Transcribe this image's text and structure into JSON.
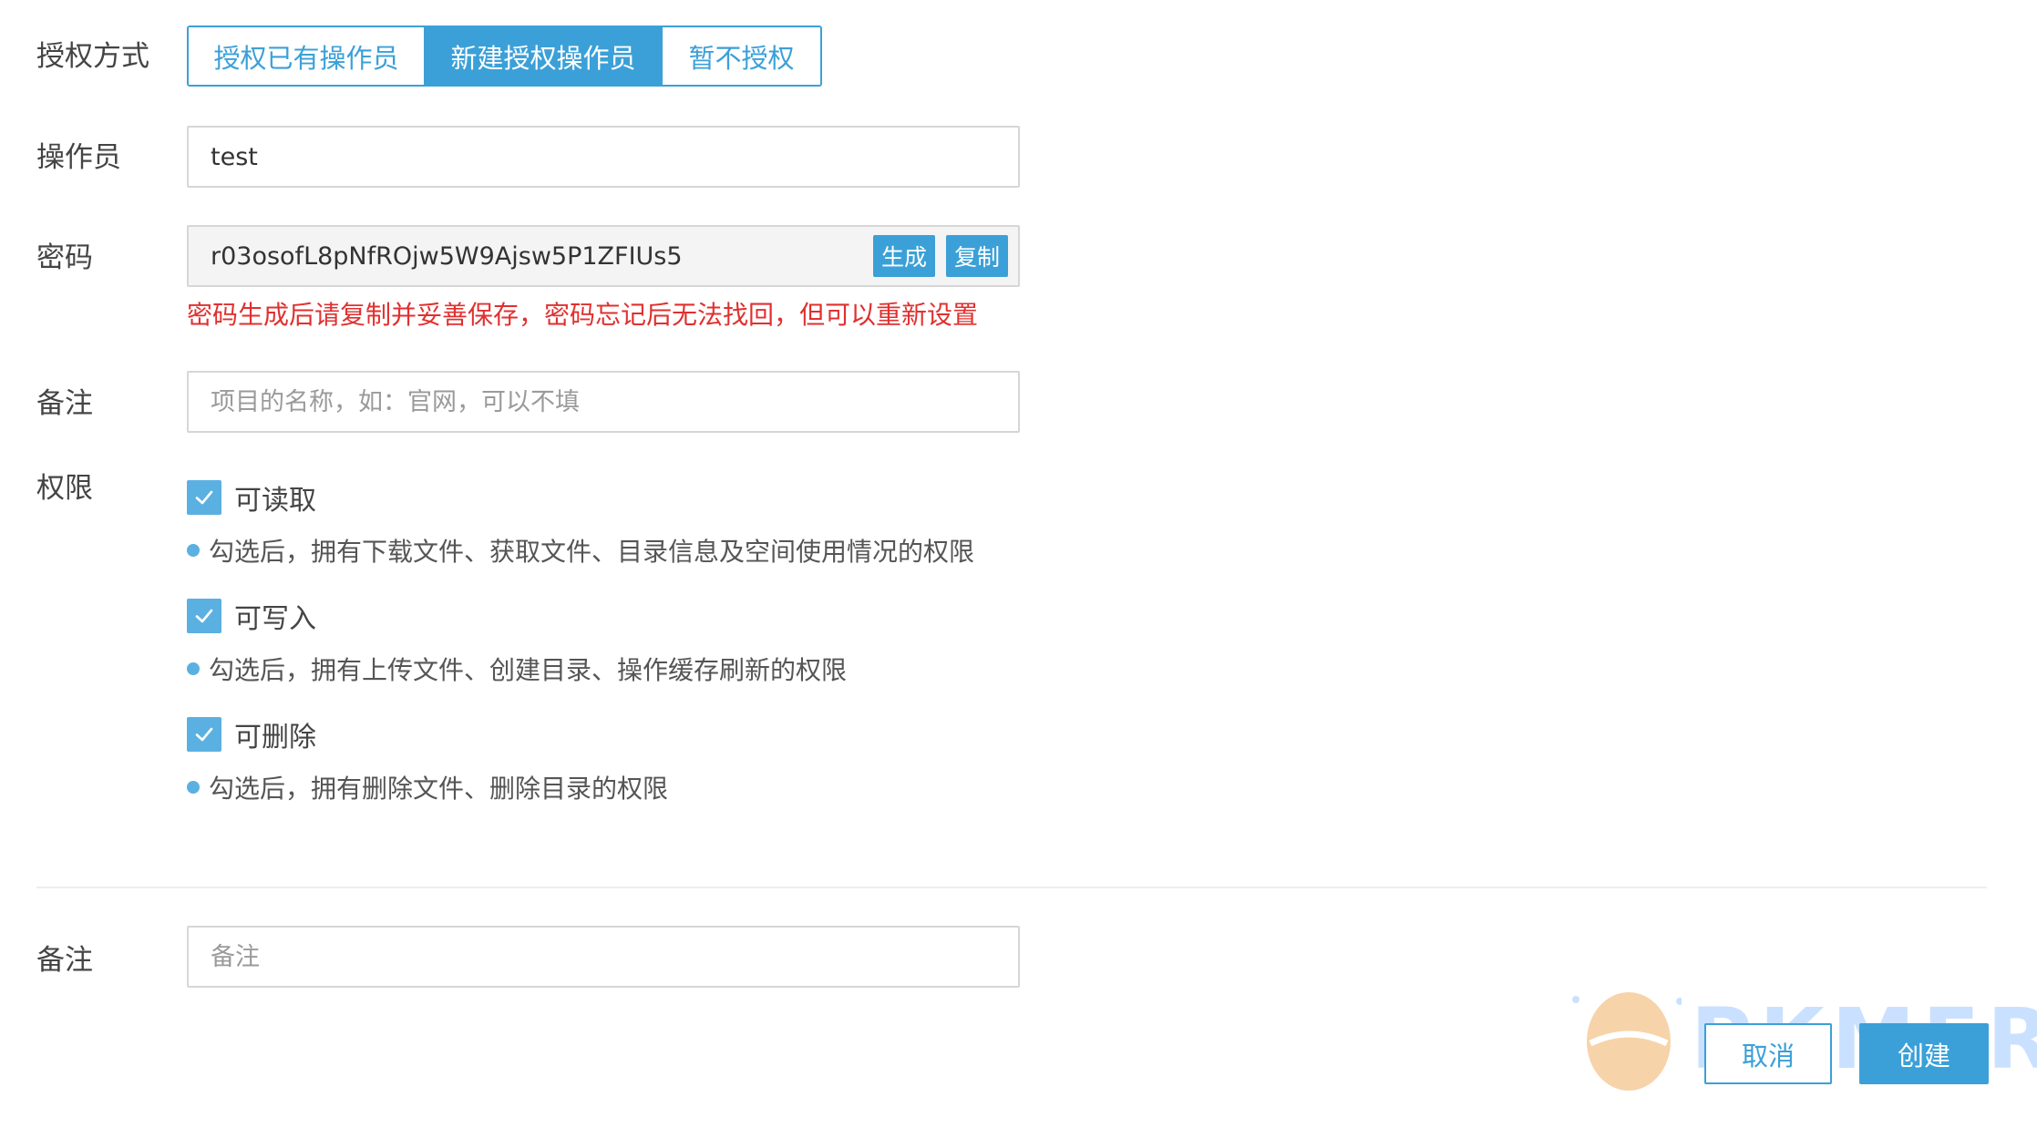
{
  "auth": {
    "label": "授权方式",
    "options": [
      "授权已有操作员",
      "新建授权操作员",
      "暂不授权"
    ],
    "selected_index": 1
  },
  "operator": {
    "label": "操作员",
    "value": "test"
  },
  "password": {
    "label": "密码",
    "value": "r03osofL8pNfROjw5W9Ajsw5P1ZFIUs5",
    "generate_label": "生成",
    "copy_label": "复制",
    "warning": "密码生成后请复制并妥善保存，密码忘记后无法找回，但可以重新设置"
  },
  "remark1": {
    "label": "备注",
    "placeholder": "项目的名称，如：官网，可以不填"
  },
  "permissions": {
    "label": "权限",
    "items": [
      {
        "label": "可读取",
        "checked": true,
        "desc": "勾选后，拥有下载文件、获取文件、目录信息及空间使用情况的权限"
      },
      {
        "label": "可写入",
        "checked": true,
        "desc": "勾选后，拥有上传文件、创建目录、操作缓存刷新的权限"
      },
      {
        "label": "可删除",
        "checked": true,
        "desc": "勾选后，拥有删除文件、删除目录的权限"
      }
    ]
  },
  "remark2": {
    "label": "备注",
    "placeholder": "备注"
  },
  "footer": {
    "cancel_label": "取消",
    "create_label": "创建"
  },
  "watermark": {
    "text": "PKMER"
  },
  "colors": {
    "accent": "#3ba0d8",
    "warning": "#e0302f",
    "checkbox": "#5bb0e2"
  }
}
